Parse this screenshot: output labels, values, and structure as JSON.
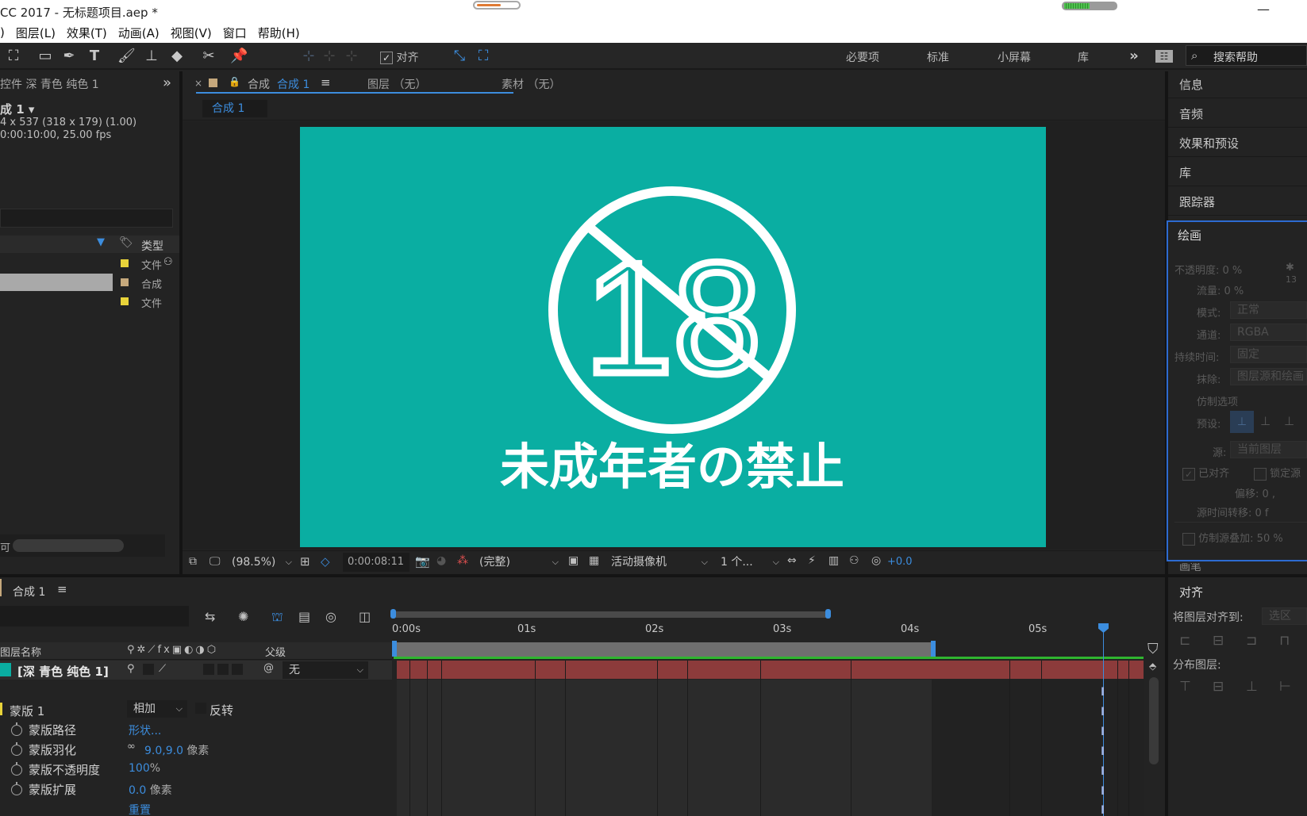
{
  "window": {
    "title": "CC 2017 - 无标题项目.aep *"
  },
  "menu": [
    ")",
    "图层(L)",
    "效果(T)",
    "动画(A)",
    "视图(V)",
    "窗口",
    "帮助(H)"
  ],
  "toolbar": {
    "align_label": "对齐",
    "workspaces": [
      "必要项",
      "标准",
      "小屏幕",
      "库"
    ],
    "search_placeholder": "搜索帮助"
  },
  "project_panel": {
    "header": "控件 深 青色 纯色 1",
    "comp_name": "成 1 ▾",
    "dims": "4 x 537  (318 x 179) (1.00)",
    "duration": "0:00:10:00, 25.00 fps",
    "type_col": "类型",
    "rows": [
      {
        "type": "文件",
        "color": "#e8d33a"
      },
      {
        "type": "合成",
        "color": "#c5a87c"
      },
      {
        "type": "文件",
        "color": "#e8d33a"
      }
    ],
    "footer_label": "可"
  },
  "comp_panel": {
    "tab_comp_prefix": "合成",
    "tab_comp_name": "合成 1",
    "tab_layer": "图层 （无）",
    "tab_footage": "素材 （无）",
    "breadcrumb": "合成 1"
  },
  "canvas": {
    "bg_color": "#0aaea2",
    "number": "18",
    "caption": "未成年者の禁止"
  },
  "viewer_bar": {
    "zoom": "(98.5%)",
    "timecode": "0:00:08:11",
    "quality": "(完整)",
    "camera": "活动摄像机",
    "views": "1 个...",
    "exposure": "+0.0"
  },
  "right_panels": [
    "信息",
    "音频",
    "效果和预设",
    "库",
    "跟踪器",
    "绘画"
  ],
  "paint_panel": {
    "opacity_label": "不透明度:",
    "opacity_value": "0 %",
    "flow_label": "流量:",
    "flow_value": "0 %",
    "size": "13",
    "mode_label": "模式:",
    "mode_value": "正常",
    "channel_label": "通道:",
    "channel_value": "RGBA",
    "duration_label": "持续时间:",
    "duration_value": "固定",
    "erase_label": "抹除:",
    "erase_value": "图层源和绘画",
    "clone_options": "仿制选项",
    "preset_label": "预设:",
    "source_label": "源:",
    "source_value": "当前图层",
    "aligned": "已对齐",
    "lock_source": "锁定源",
    "offset_label": "偏移:",
    "offset_value": "0 ,",
    "time_shift_label": "源时间转移:",
    "time_shift_value": "0 f",
    "overlay_label": "仿制源叠加:",
    "overlay_value": "50 %",
    "next_panel_partial": "画笔"
  },
  "align_panel": {
    "title": "对齐",
    "align_to_label": "将图层对齐到:",
    "align_to_value": "选区",
    "distribute_label": "分布图层:"
  },
  "timeline": {
    "tab_name": "合成 1",
    "col_layer_name": "图层名称",
    "col_parent": "父级",
    "layer_name": "[深 青色 纯色 1]",
    "layer_color": "#0aaea2",
    "parent_value": "无",
    "ruler_labels": [
      "0:00s",
      "01s",
      "02s",
      "03s",
      "04s",
      "05s"
    ],
    "mask_name": "蒙版 1",
    "mask_mode": "相加",
    "invert_label": "反转",
    "props": [
      {
        "name": "蒙版路径",
        "value": "形状...",
        "unit": ""
      },
      {
        "name": "蒙版羽化",
        "value": "9.0,9.0",
        "unit": " 像素"
      },
      {
        "name": "蒙版不透明度",
        "value": "100",
        "unit": "%"
      },
      {
        "name": "蒙版扩展",
        "value": "0.0",
        "unit": " 像素"
      }
    ],
    "reset_label": "重置"
  }
}
